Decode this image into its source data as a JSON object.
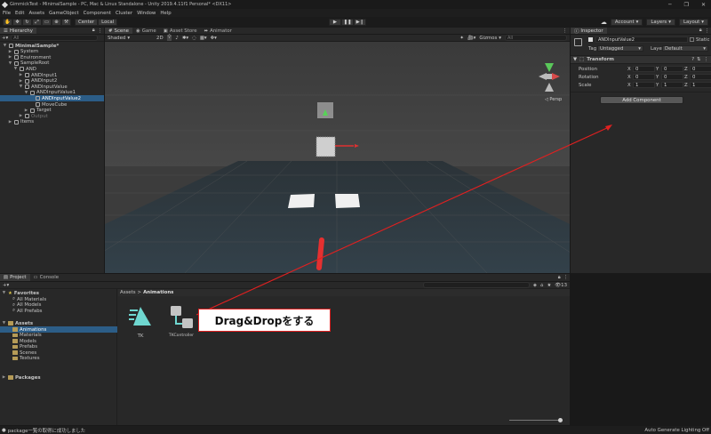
{
  "window": {
    "title": "GimmickTest - MinimalSample - PC, Mac & Linux Standalone - Unity 2019.4.11f1 Personal* <DX11>",
    "controls": [
      "─",
      "❐",
      "✕"
    ]
  },
  "menu": [
    "File",
    "Edit",
    "Assets",
    "GameObject",
    "Component",
    "Cluster",
    "Window",
    "Help"
  ],
  "toolbar": {
    "pivot": "Center",
    "space": "Local",
    "account": "Account",
    "layers": "Layers",
    "layout": "Layout"
  },
  "hierarchy": {
    "tab": "Hierarchy",
    "search_placeholder": "All",
    "items": [
      {
        "label": "MinimalSample*",
        "depth": 0,
        "arrow": "▼"
      },
      {
        "label": "System",
        "depth": 1,
        "arrow": "▶"
      },
      {
        "label": "Environment",
        "depth": 1,
        "arrow": "▶"
      },
      {
        "label": "SampleRoot",
        "depth": 1,
        "arrow": "▼"
      },
      {
        "label": "AND",
        "depth": 2,
        "arrow": "▼"
      },
      {
        "label": "ANDInput1",
        "depth": 3,
        "arrow": "▶"
      },
      {
        "label": "ANDInput2",
        "depth": 3,
        "arrow": "▶"
      },
      {
        "label": "ANDInputValue",
        "depth": 3,
        "arrow": "▼"
      },
      {
        "label": "ANDInputValue1",
        "depth": 4,
        "arrow": "▼"
      },
      {
        "label": "ANDInputValue2",
        "depth": 5,
        "arrow": "",
        "selected": true
      },
      {
        "label": "MoveCube",
        "depth": 5,
        "arrow": ""
      },
      {
        "label": "Target",
        "depth": 4,
        "arrow": "▶"
      },
      {
        "label": "Output",
        "depth": 3,
        "arrow": "▶",
        "dim": true
      },
      {
        "label": "Items",
        "depth": 1,
        "arrow": "▶"
      }
    ]
  },
  "scene": {
    "tabs": [
      "Scene",
      "Game",
      "Asset Store",
      "Animator"
    ],
    "shading": "Shaded",
    "mode2d": "2D",
    "gizmos": "Gizmos",
    "search_placeholder": "All",
    "persp": "◁ Persp"
  },
  "inspector": {
    "tab": "Inspector",
    "object_name": "ANDInputValue2",
    "static_label": "Static",
    "tag_label": "Tag",
    "tag_value": "Untagged",
    "layer_label": "Layer",
    "layer_value": "Default",
    "transform_title": "Transform",
    "rows": [
      {
        "label": "Position",
        "x": "0",
        "y": "0",
        "z": "0"
      },
      {
        "label": "Rotation",
        "x": "0",
        "y": "0",
        "z": "0"
      },
      {
        "label": "Scale",
        "x": "1",
        "y": "1",
        "z": "1"
      }
    ],
    "axis": {
      "x": "X",
      "y": "Y",
      "z": "Z"
    },
    "add_component": "Add Component"
  },
  "project": {
    "tabs": [
      "Project",
      "Console"
    ],
    "favorites": {
      "label": "Favorites",
      "items": [
        "All Materials",
        "All Models",
        "All Prefabs"
      ]
    },
    "assets": {
      "label": "Assets",
      "items": [
        "Animations",
        "Materials",
        "Models",
        "Prefabs",
        "Scenes",
        "Textures"
      ]
    },
    "packages": "Packages",
    "breadcrumb": {
      "root": "Assets",
      "sep": ">",
      "current": "Animations"
    },
    "files": [
      {
        "name": "TK",
        "icon": "animation-clip-icon"
      },
      {
        "name": "TKController",
        "icon": "animator-controller-icon"
      }
    ]
  },
  "annotation": {
    "text": "Drag&Dropをする",
    "color": "#e02020"
  },
  "status": {
    "message": "package一覧の取得に成功しました",
    "right": "Auto Generate Lighting Off"
  },
  "colors": {
    "accent": "#2c5d87",
    "selected": "#2c5d87",
    "annotation": "#e02020",
    "animation_icon": "#6fd7d0"
  }
}
